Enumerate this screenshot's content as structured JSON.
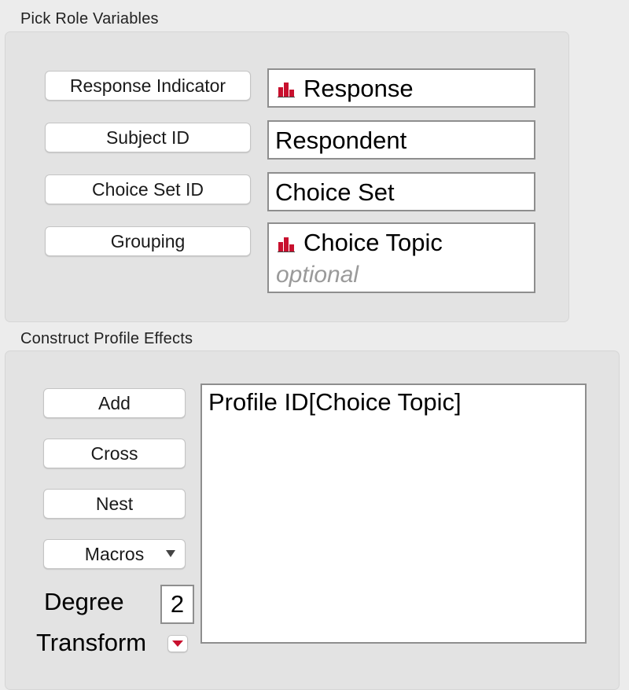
{
  "role_section": {
    "title": "Pick Role Variables",
    "roles": [
      {
        "button": "Response Indicator",
        "value": "Response",
        "icon": "bar-chart-icon"
      },
      {
        "button": "Subject ID",
        "value": "Respondent"
      },
      {
        "button": "Choice Set ID",
        "value": "Choice Set"
      },
      {
        "button": "Grouping",
        "value": "Choice Topic",
        "icon": "bar-chart-icon",
        "placeholder": "optional"
      }
    ]
  },
  "effects_section": {
    "title": "Construct Profile Effects",
    "buttons": {
      "add": "Add",
      "cross": "Cross",
      "nest": "Nest",
      "macros": "Macros"
    },
    "degree_label": "Degree",
    "degree_value": "2",
    "transform_label": "Transform",
    "effects": [
      "Profile ID[Choice Topic]"
    ]
  },
  "colors": {
    "icon_red": "#c8102e",
    "accent_triangle": "#c8102e"
  }
}
